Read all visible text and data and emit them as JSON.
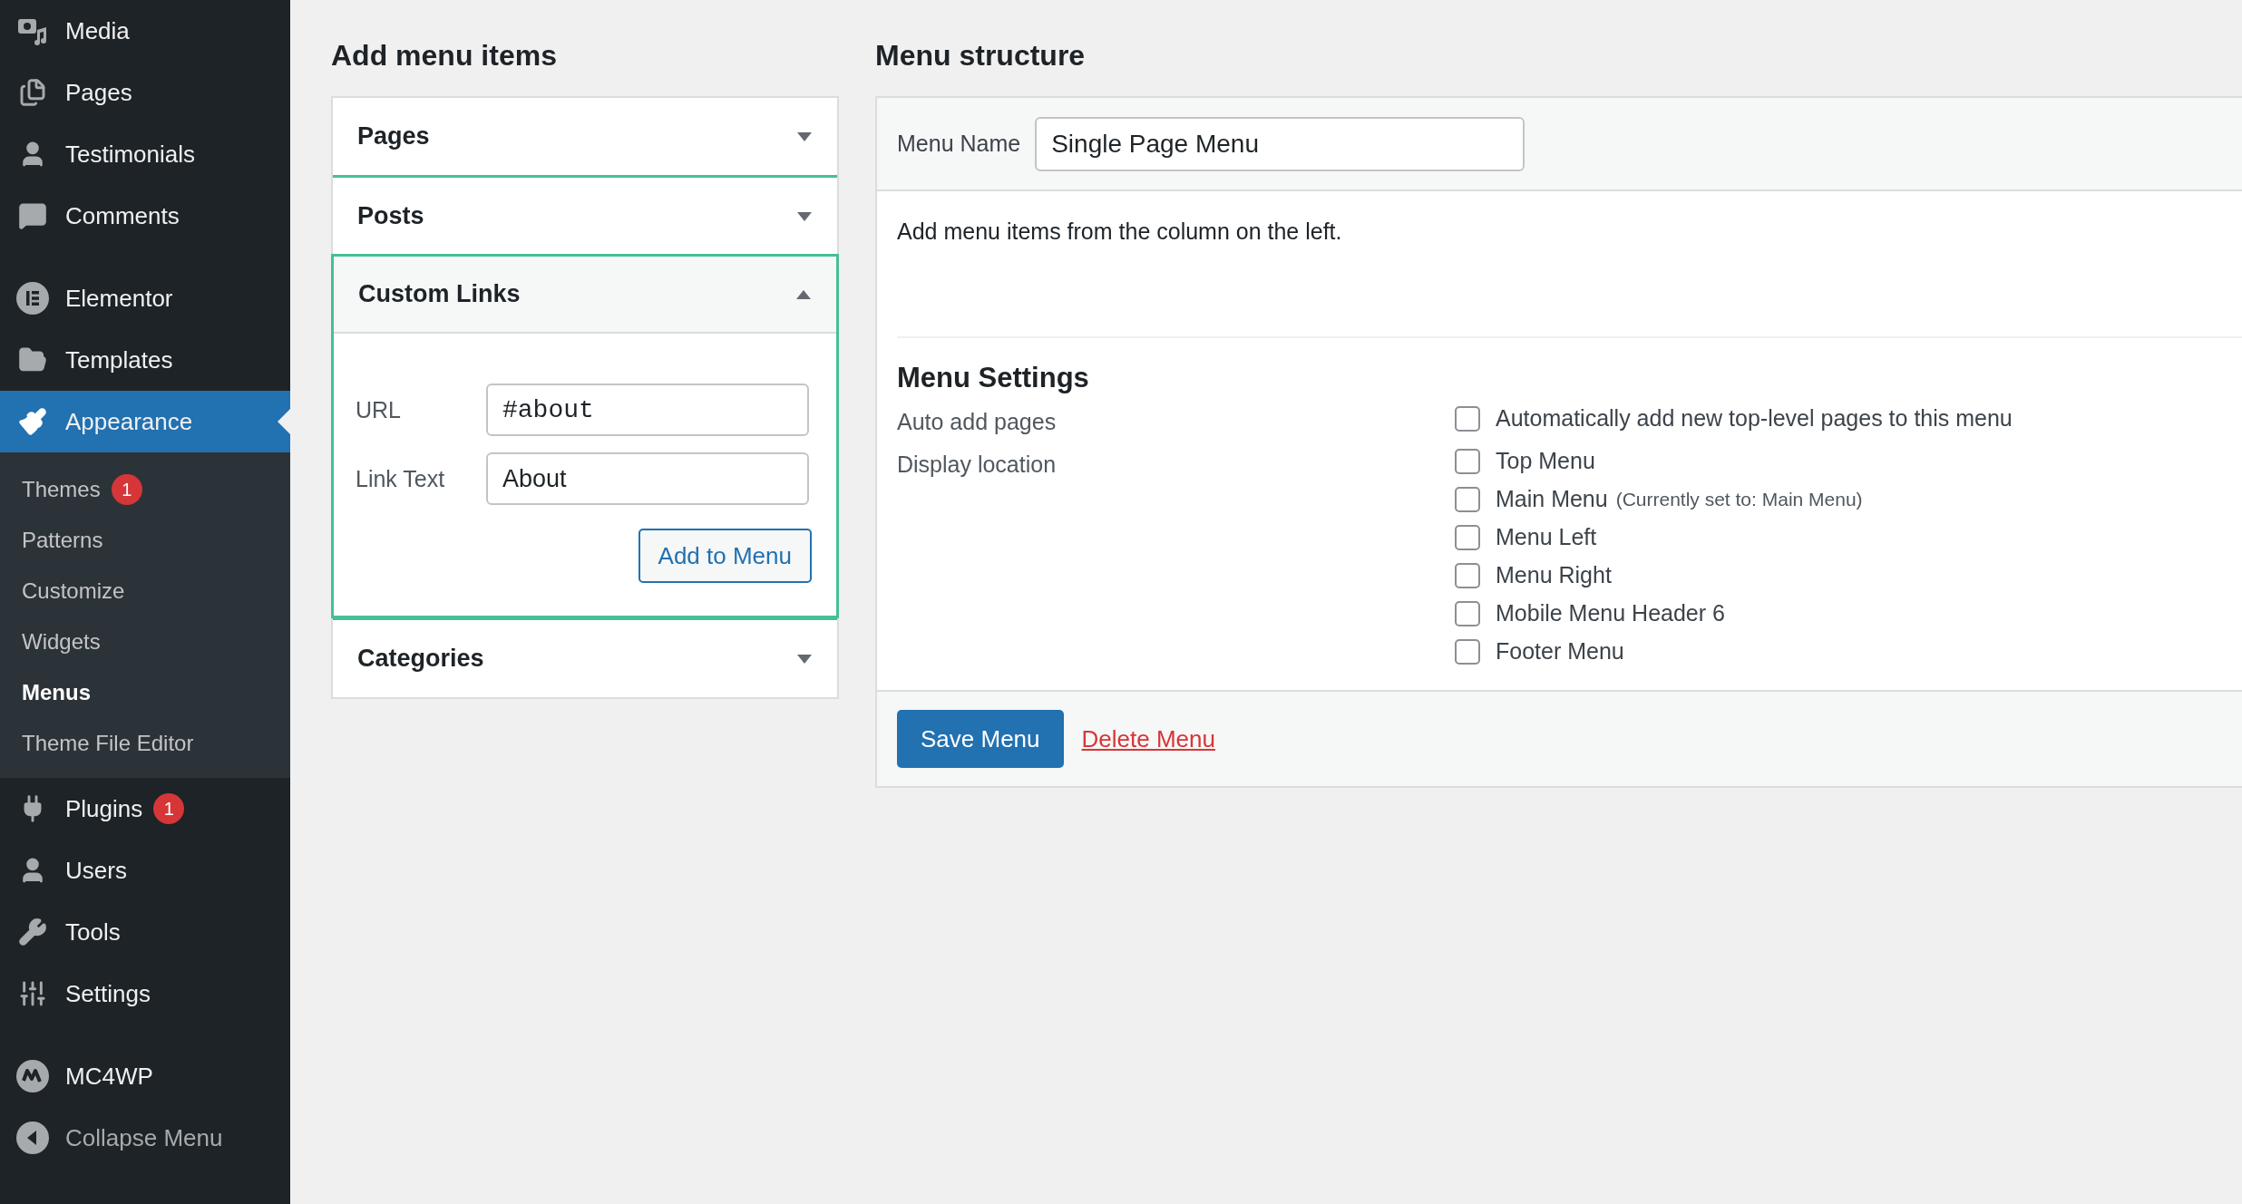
{
  "sidebar": {
    "groups": [
      {
        "items": [
          {
            "label": "Media",
            "selected": false
          },
          {
            "label": "Pages",
            "selected": false
          },
          {
            "label": "Testimonials",
            "selected": false
          },
          {
            "label": "Comments",
            "selected": false
          }
        ]
      },
      {
        "items": [
          {
            "label": "Elementor",
            "selected": false
          },
          {
            "label": "Templates",
            "selected": false
          },
          {
            "label": "Appearance",
            "selected": true,
            "expanded": true,
            "children": [
              {
                "label": "Themes",
                "selected": false,
                "badge": "1"
              },
              {
                "label": "Patterns",
                "selected": false
              },
              {
                "label": "Customize",
                "selected": false
              },
              {
                "label": "Widgets",
                "selected": false
              },
              {
                "label": "Menus",
                "selected": true
              },
              {
                "label": "Theme File Editor",
                "selected": false
              }
            ]
          },
          {
            "label": "Plugins",
            "selected": false,
            "badge": "1"
          },
          {
            "label": "Users",
            "selected": false
          },
          {
            "label": "Tools",
            "selected": false
          },
          {
            "label": "Settings",
            "selected": false
          }
        ]
      },
      {
        "items": [
          {
            "label": "MC4WP",
            "selected": false
          },
          {
            "label": "Collapse Menu",
            "selected": false,
            "kind": "collapse"
          }
        ]
      }
    ]
  },
  "add_menu_items": {
    "title": "Add menu items",
    "sections": [
      {
        "title": "Pages",
        "expanded": false
      },
      {
        "title": "Posts",
        "expanded": false
      },
      {
        "title": "Custom Links",
        "expanded": true,
        "fields": [
          {
            "label": "URL",
            "value": "#about",
            "kind": "url"
          },
          {
            "label": "Link Text",
            "value": "About",
            "kind": "text"
          }
        ],
        "button": "Add to Menu"
      },
      {
        "title": "Categories",
        "expanded": false
      }
    ]
  },
  "menu_structure": {
    "title": "Menu structure",
    "menu_name": {
      "label": "Menu Name",
      "value": "Single Page Menu"
    },
    "hint": "Add menu items from the column on the left.",
    "settings": {
      "title": "Menu Settings",
      "rows": [
        {
          "label": "Auto add pages",
          "options": [
            {
              "label": "Automatically add new top-level pages to this menu",
              "checked": false
            }
          ]
        },
        {
          "label": "Display location",
          "options": [
            {
              "label": "Top Menu",
              "checked": false
            },
            {
              "label": "Main Menu",
              "note": "(Currently set to: Main Menu)",
              "checked": false
            },
            {
              "label": "Menu Left",
              "checked": false
            },
            {
              "label": "Menu Right",
              "checked": false
            },
            {
              "label": "Mobile Menu Header 6",
              "checked": false
            },
            {
              "label": "Footer Menu",
              "checked": false
            }
          ]
        }
      ]
    },
    "save_button": "Save Menu",
    "delete_link": "Delete Menu"
  }
}
